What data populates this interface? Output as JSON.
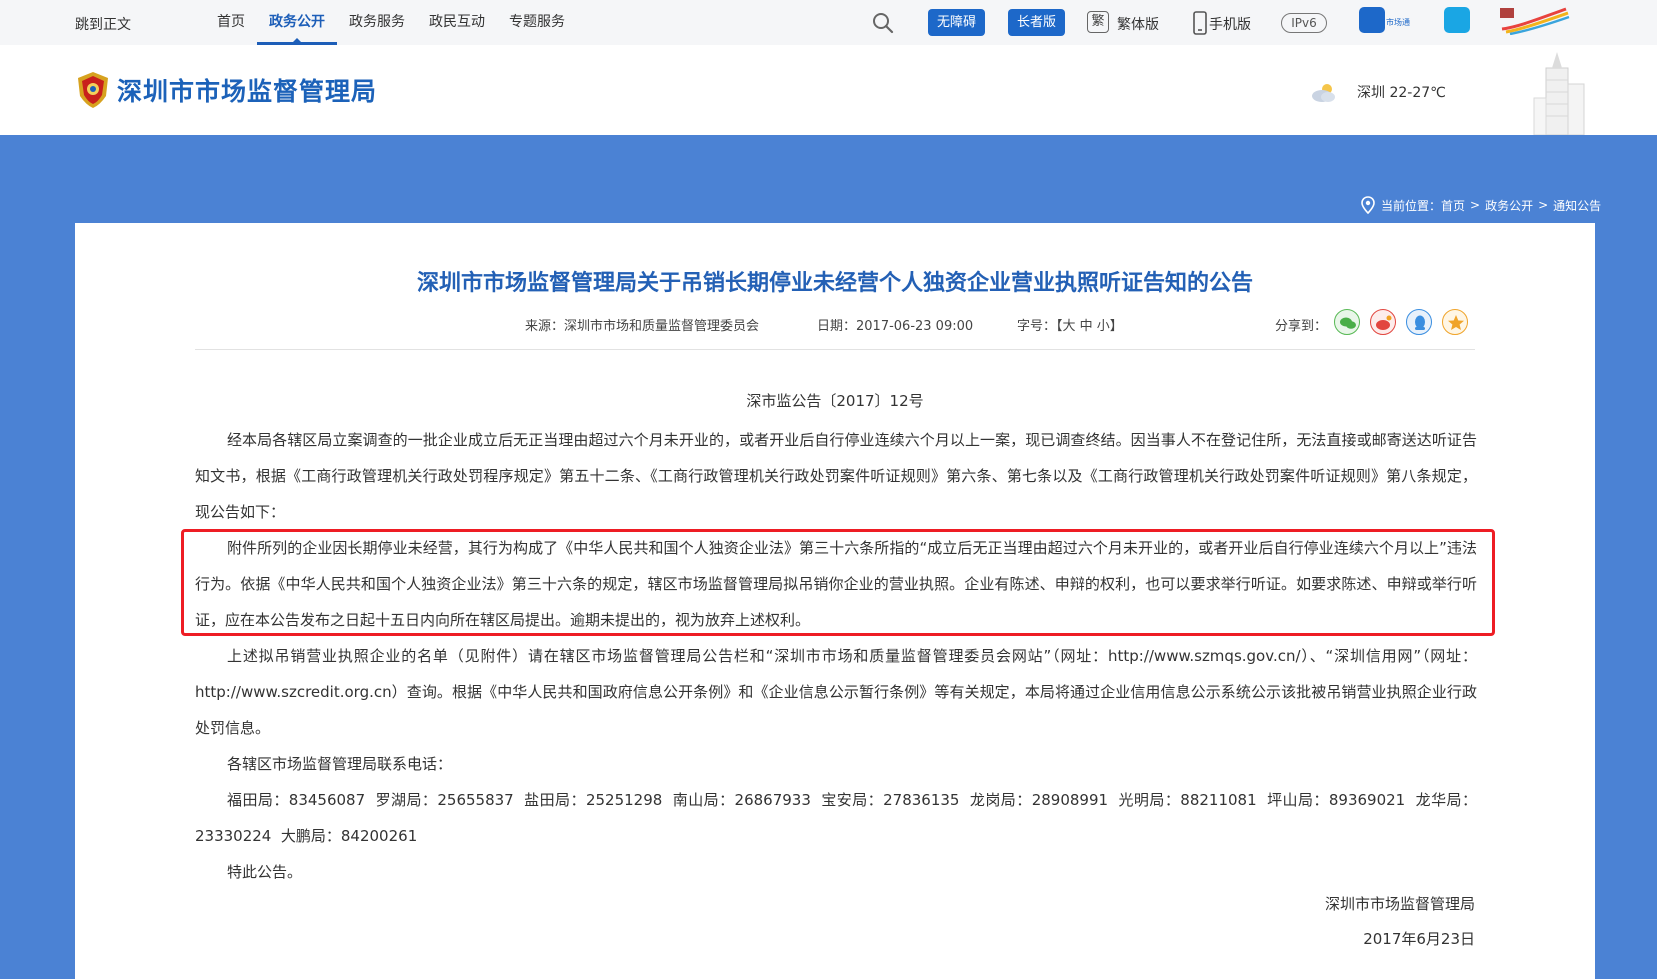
{
  "topbar": {
    "skip_link": "跳到正文",
    "nav": [
      "首页",
      "政务公开",
      "政务服务",
      "政民互动",
      "专题服务"
    ],
    "active_nav": "政务公开",
    "accessibility_button": "无障碍",
    "elder_button": "长者版",
    "traditional_label": "繁体版",
    "traditional_icon_glyph": "繁",
    "mobile_label": "手机版",
    "ipv6_label": "IPv6",
    "market_app_label": "市场通"
  },
  "header": {
    "site_name": "深圳市市场监督管理局",
    "weather": "深圳 22-27℃"
  },
  "breadcrumb": {
    "prefix": "当前位置：",
    "items": [
      "首页",
      "政务公开",
      "通知公告"
    ],
    "separator": ">"
  },
  "article": {
    "title": "深圳市市场监督管理局关于吊销长期停业未经营个人独资企业营业执照听证告知的公告",
    "source": "来源：深圳市市场和质量监督管理委员会",
    "date": "日期：2017-06-23 09:00",
    "font_size_label": "字号：【大  中  小】",
    "share_label": "分享到：",
    "doc_number": "深市监公告〔2017〕12号",
    "paragraphs": [
      "经本局各辖区局立案调查的一批企业成立后无正当理由超过六个月未开业的，或者开业后自行停业连续六个月以上一案，现已调查终结。因当事人不在登记住所，无法直接或邮寄送达听证告知文书，根据《工商行政管理机关行政处罚程序规定》第五十二条、《工商行政管理机关行政处罚案件听证规则》第六条、第七条以及《工商行政管理机关行政处罚案件听证规则》第八条规定，现公告如下：",
      "附件所列的企业因长期停业未经营，其行为构成了《中华人民共和国个人独资企业法》第三十六条所指的“成立后无正当理由超过六个月未开业的，或者开业后自行停业连续六个月以上”违法行为。依据《中华人民共和国个人独资企业法》第三十六条的规定，辖区市场监督管理局拟吊销你企业的营业执照。企业有陈述、申辩的权利，也可以要求举行听证。如要求陈述、申辩或举行听证，应在本公告发布之日起十五日内向所在辖区局提出。逾期未提出的，视为放弃上述权利。",
      "上述拟吊销营业执照企业的名单（见附件）请在辖区市场监督管理局公告栏和“深圳市市场和质量监督管理委员会网站”（网址：http://www.szmqs.gov.cn/）、“深圳信用网”（网址：http://www.szcredit.org.cn）查询。根据《中华人民共和国政府信息公开条例》和《企业信息公示暂行条例》等有关规定，本局将通过企业信用信息公示系统公示该批被吊销营业执照企业行政处罚信息。",
      "各辖区市场监督管理局联系电话：",
      "福田局：83456087  罗湖局：25655837  盐田局：25251298  南山局：26867933  宝安局：27836135  龙岗局：28908991  光明局：88211081  坪山局：89369021  龙华局：23330224  大鹏局：84200261",
      "特此公告。"
    ],
    "signature": "深圳市市场监督管理局",
    "sign_date": "2017年6月23日"
  },
  "colors": {
    "brand_blue": "#1c62b9",
    "band_blue": "#4b82d4",
    "highlight_red": "#ee1d24"
  }
}
